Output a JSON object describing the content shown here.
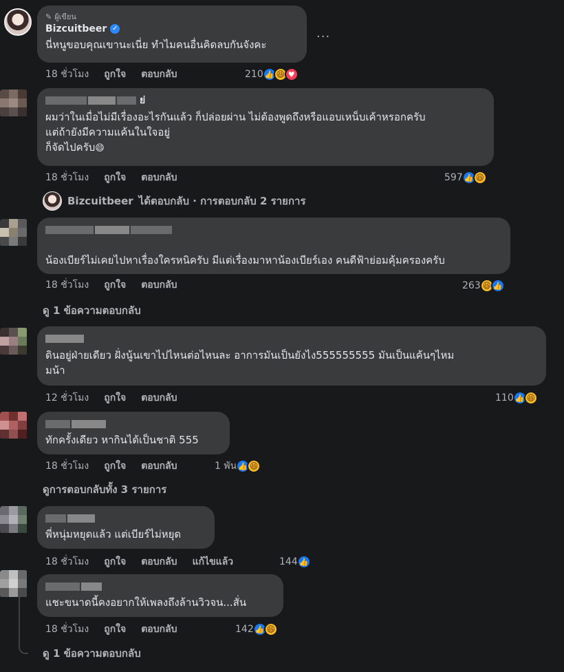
{
  "comments": [
    {
      "author_tag": "ผู้เขียน",
      "name": "Bizcuitbeer",
      "text": "นี่หนูขอบคุณเขานะเนี่ย ทำไมคนอื่นคิดลบกันจังคะ",
      "time": "18 ชั่วโมง",
      "like": "ถูกใจ",
      "reply": "ตอบกลับ",
      "count": "210",
      "more": "..."
    },
    {
      "name_suffix": "ย่",
      "text": "ผมว่าในเมื่อไม่มีเรื่องอะไรกันแล้ว ก็ปล่อยผ่าน ไม่ต้องพูดถึงหรือแอบเหน็บเค้าหรอกครับ\nแต่ถ้ายังมีความแค้นในใจอยู่\nก็จัดไปครับ",
      "emoji": "😄",
      "time": "18 ชั่วโมง",
      "like": "ถูกใจ",
      "reply": "ตอบกลับ",
      "count": "597"
    },
    {
      "text": "น้องเบียร์ไม่เคยไปหาเรื่องใครหนิครับ มีแต่เรื่องมาหาน้องเบียร์เอง คนดีฟ้าย่อมคุ้มครองครับ",
      "time": "18 ชั่วโมง",
      "like": "ถูกใจ",
      "reply": "ตอบกลับ",
      "count": "263"
    },
    {
      "text": "ดินอยู่ฝ่ายเดียว ฝั่งนู้นเขาไปไหนต่อไหนละ อาการมันเป็นยังไง555555555 มันเป็นแค้นๆไหม\nมน้า",
      "time": "12 ชั่วโมง",
      "like": "ถูกใจ",
      "reply": "ตอบกลับ",
      "count": "110"
    },
    {
      "text": "ทักครั้งเดียว หากินได้เป็นชาติ 555",
      "time": "18 ชั่วโมง",
      "like": "ถูกใจ",
      "reply": "ตอบกลับ",
      "count": "1 พัน"
    },
    {
      "text": "พี่หนุ่มหยุดแล้ว แต่เบียร์ไม่หยุด",
      "time": "18 ชั่วโมง",
      "like": "ถูกใจ",
      "reply": "ตอบกลับ",
      "edited": "แก้ไขแล้ว",
      "count": "144"
    },
    {
      "text": "แชะขนาดนี้คงอยากให้เพลงถึงล้านวิวจน...สั่น",
      "time": "18 ชั่วโมง",
      "like": "ถูกใจ",
      "reply": "ตอบกลับ",
      "count": "142"
    }
  ],
  "replies_summary": {
    "name": "Bizcuitbeer",
    "text": "ได้ตอบกลับ · การตอบกลับ 2 รายการ"
  },
  "view_replies": {
    "one": "ดู 1 ข้อความตอบกลับ",
    "all3": "ดูการตอบกลับทั้ง 3 รายการ",
    "one_b": "ดู 1 ข้อความตอบกลับ"
  },
  "icons": {
    "like": "like-icon",
    "haha": "haha-icon",
    "love": "love-icon",
    "verified": "verified-badge-icon",
    "author": "pen-icon"
  },
  "colors": {
    "background": "#18191a",
    "bubble": "#3a3b3c",
    "like": "#1877f2",
    "haha": "#f7b928",
    "love": "#f33e58"
  }
}
